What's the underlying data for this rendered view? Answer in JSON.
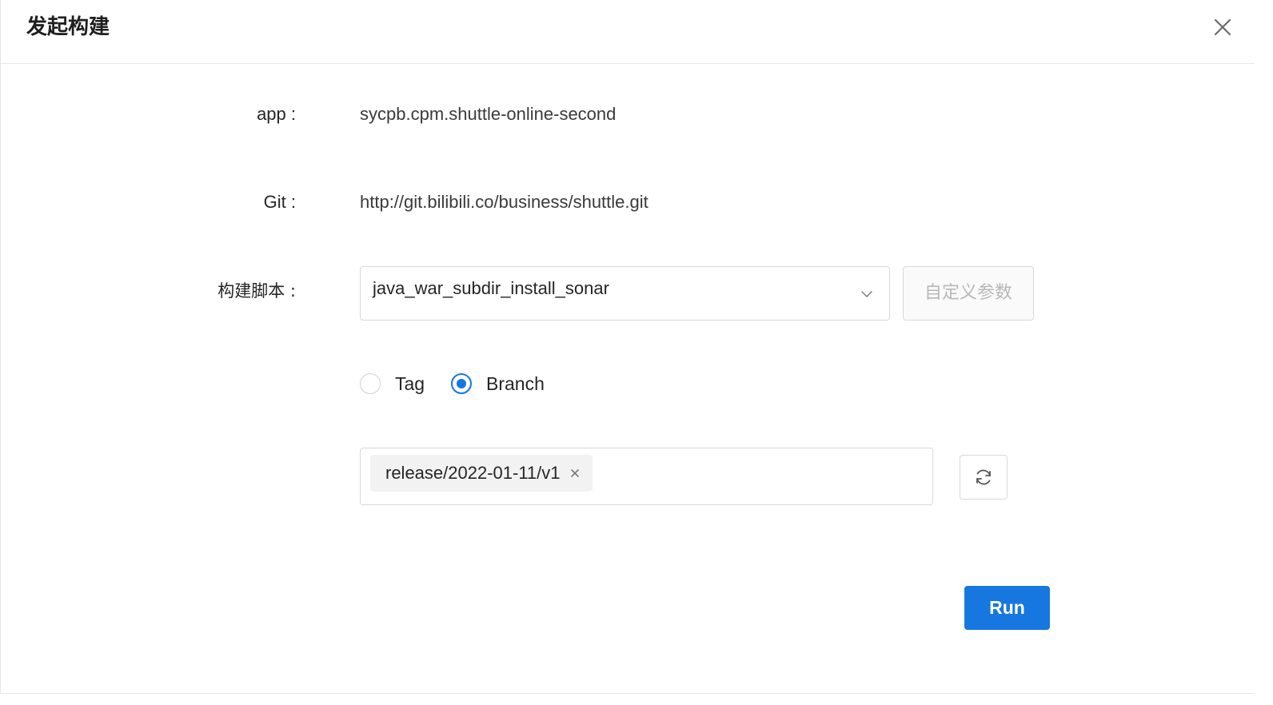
{
  "dialog": {
    "title": "发起构建"
  },
  "form": {
    "app": {
      "label": "app :",
      "value": "sycpb.cpm.shuttle-online-second"
    },
    "git": {
      "label": "Git :",
      "value": "http://git.bilibili.co/business/shuttle.git"
    },
    "script": {
      "label": "构建脚本 :",
      "selected": "java_war_subdir_install_sonar",
      "custom_button": "自定义参数"
    },
    "ref_type": {
      "options": [
        {
          "label": "Tag",
          "checked": false
        },
        {
          "label": "Branch",
          "checked": true
        }
      ]
    },
    "branch": {
      "selected_tags": [
        "release/2022-01-11/v1"
      ]
    },
    "run_button": "Run"
  },
  "colors": {
    "primary": "#1677e0",
    "border": "#d9d9d9",
    "disabled_text": "#b8b8b8"
  }
}
